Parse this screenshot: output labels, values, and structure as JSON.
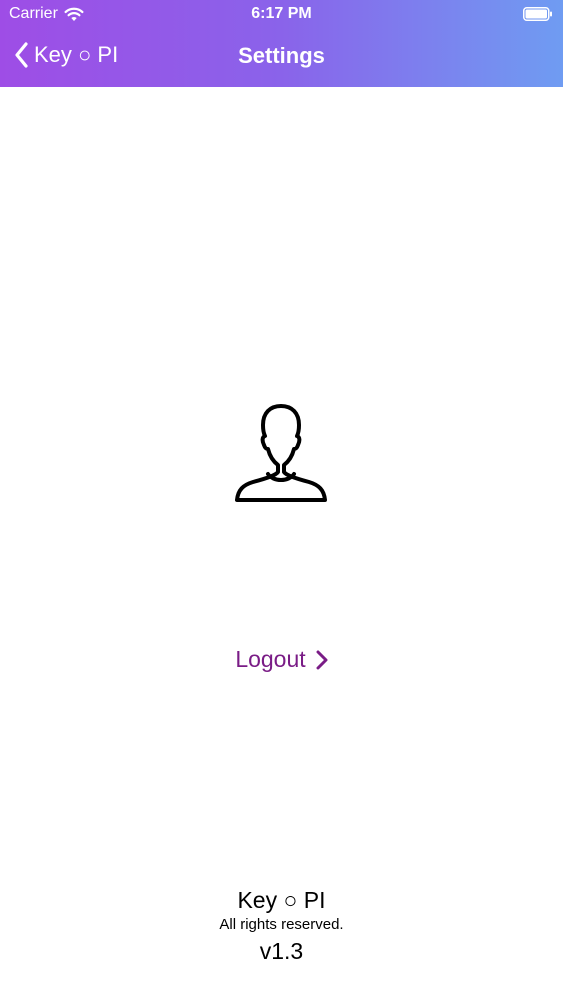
{
  "status_bar": {
    "carrier": "Carrier",
    "time": "6:17 PM",
    "wifi_icon": "wifi-icon",
    "battery_icon": "battery-icon"
  },
  "nav": {
    "back_label": "Key ○ PI",
    "back_icon": "chevron-left-icon",
    "title": "Settings"
  },
  "main": {
    "avatar_icon": "user-avatar-icon",
    "logout_label": "Logout",
    "logout_icon": "chevron-right-icon"
  },
  "footer": {
    "app_name": "Key ○ PI",
    "rights": "All rights reserved.",
    "version": "v1.3"
  },
  "colors": {
    "header_gradient_start": "#9e4de6",
    "header_gradient_end": "#6f9cf2",
    "logout_color": "#7a1c86"
  }
}
